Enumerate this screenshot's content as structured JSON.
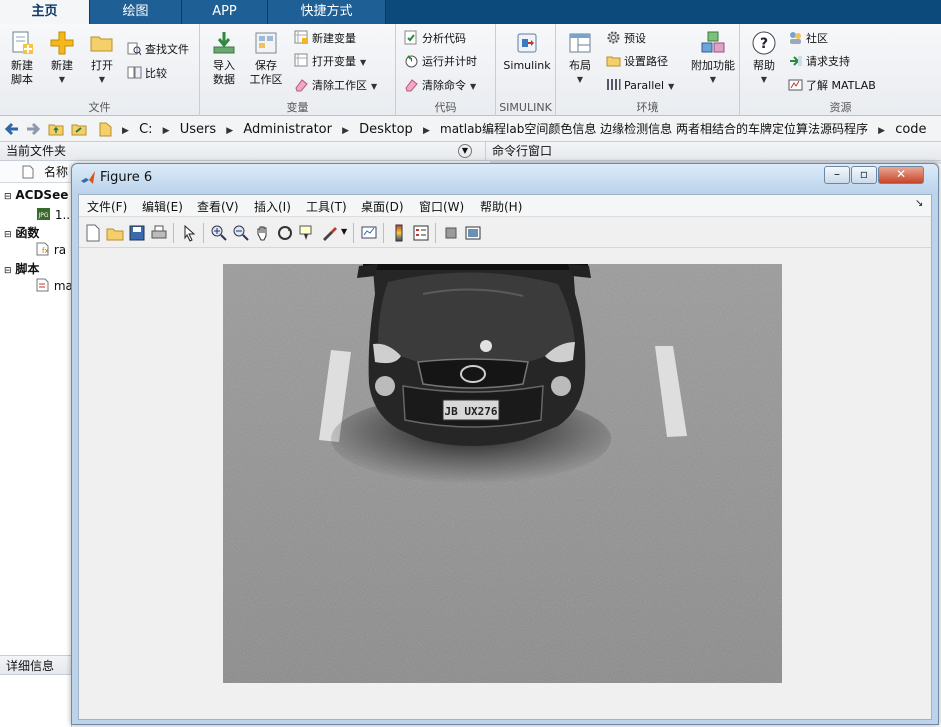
{
  "tabs": [
    {
      "label": "主页",
      "active": true
    },
    {
      "label": "绘图",
      "active": false
    },
    {
      "label": "APP",
      "active": false
    },
    {
      "label": "快捷方式",
      "active": false
    }
  ],
  "ribbon": {
    "groups": {
      "file": "文件",
      "variable": "变量",
      "code": "代码",
      "simulink": "SIMULINK",
      "environment": "环境",
      "resources": "资源"
    },
    "new_script": [
      "新建",
      "脚本"
    ],
    "new": "新建",
    "open": "打开",
    "find_files": "查找文件",
    "compare": "比较",
    "import_data": [
      "导入",
      "数据"
    ],
    "save_workspace": [
      "保存",
      "工作区"
    ],
    "new_variable": "新建变量",
    "open_variable": "打开变量",
    "clear_workspace": "清除工作区",
    "analyze_code": "分析代码",
    "run_and_time": "运行并计时",
    "clear_commands": "清除命令",
    "simulink": "Simulink",
    "layout": "布局",
    "preferences": "预设",
    "set_path": "设置路径",
    "parallel": "Parallel",
    "add_ons": "附加功能",
    "help": "帮助",
    "community": "社区",
    "request_support": "请求支持",
    "learn_matlab": "了解 MATLAB"
  },
  "address": {
    "crumbs": [
      "C:",
      "Users",
      "Administrator",
      "Desktop",
      "matlab编程lab空间颜色信息 边缘检测信息 两者相结合的车牌定位算法源码程序",
      "code"
    ]
  },
  "panels": {
    "current_folder": "当前文件夹",
    "command_window": "命令行窗口",
    "name_column": "名称",
    "details": "详细信息"
  },
  "tree": {
    "group1": "ACDSee",
    "file1": "1...",
    "group2": "函数",
    "file2": "ra",
    "group3": "脚本",
    "file3": "ma"
  },
  "figure": {
    "title": "Figure 6",
    "menu": [
      "文件(F)",
      "编辑(E)",
      "查看(V)",
      "插入(I)",
      "工具(T)",
      "桌面(D)",
      "窗口(W)",
      "帮助(H)"
    ],
    "plate": "JB UX276"
  },
  "colors": {
    "tab_bar": "#0d4a7c",
    "ribbon_bg": "#eef0f3",
    "titlebar": "#bcd4ec"
  }
}
